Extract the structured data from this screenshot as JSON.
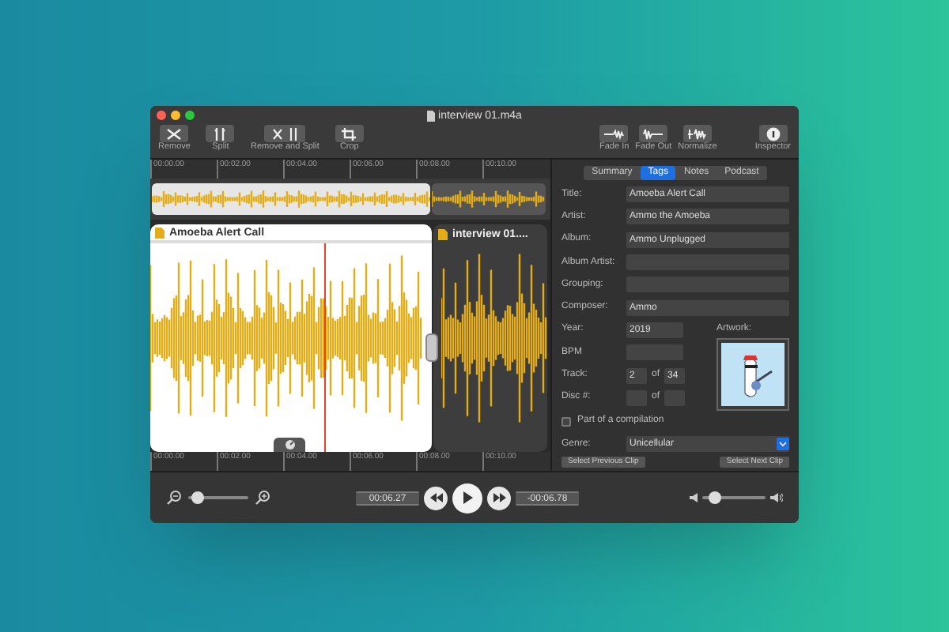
{
  "window": {
    "title": "interview 01.m4a"
  },
  "toolbar": {
    "left": [
      {
        "label": "Remove",
        "kind": "remove"
      },
      {
        "label": "Split",
        "kind": "split"
      },
      {
        "label": "Remove and Split",
        "kind": "remove_split"
      },
      {
        "label": "Crop",
        "kind": "crop"
      }
    ],
    "right": [
      {
        "label": "Fade In",
        "kind": "fade_in"
      },
      {
        "label": "Fade Out",
        "kind": "fade_out"
      },
      {
        "label": "Normalize",
        "kind": "normalize"
      },
      {
        "label": "Inspector",
        "kind": "inspector"
      }
    ]
  },
  "ruler_top": {
    "ticks": [
      "00:00.00",
      "00:02.00",
      "00:04.00",
      "00:06.00",
      "00:08.00",
      "00:10.00"
    ]
  },
  "clips": [
    {
      "title": "Amoeba Alert Call",
      "selected": true
    },
    {
      "title": "interview 01....",
      "selected": false
    }
  ],
  "ruler_bottom": {
    "ticks": [
      "00:00.00",
      "00:02.00",
      "00:04.00",
      "00:06.00",
      "00:08.00",
      "00:10.00"
    ]
  },
  "inspector": {
    "tabs": [
      {
        "label": "Summary",
        "selected": false
      },
      {
        "label": "Tags",
        "selected": true
      },
      {
        "label": "Notes",
        "selected": false
      },
      {
        "label": "Podcast",
        "selected": false
      }
    ],
    "fields": [
      {
        "label": "Title:",
        "value": "Amoeba Alert Call"
      },
      {
        "label": "Artist:",
        "value": "Ammo the Amoeba"
      },
      {
        "label": "Album:",
        "value": "Ammo Unplugged"
      },
      {
        "label": "Album Artist:"
      },
      {
        "label": "Grouping:"
      },
      {
        "label": "Composer:",
        "value": "Ammo"
      }
    ],
    "year": {
      "label": "Year:",
      "value": "2019"
    },
    "bpm": {
      "label": "BPM"
    },
    "track": {
      "label": "Track:",
      "value": "2",
      "of": "of",
      "total": "34"
    },
    "disc": {
      "label": "Disc #:",
      "of": "of"
    },
    "artwork": {
      "label": "Artwork:"
    },
    "compilation": {
      "label": "Part of a compilation",
      "checked": false
    },
    "genre": {
      "label": "Genre:",
      "value": "Unicellular"
    },
    "buttons": [
      "Select Previous Clip",
      "Select Next Clip"
    ]
  },
  "transport": {
    "zoom": {
      "level": 0.05
    },
    "elapsed": "00:06.27",
    "remaining": "-00:06.78",
    "volume": {
      "level": 0.12
    }
  }
}
